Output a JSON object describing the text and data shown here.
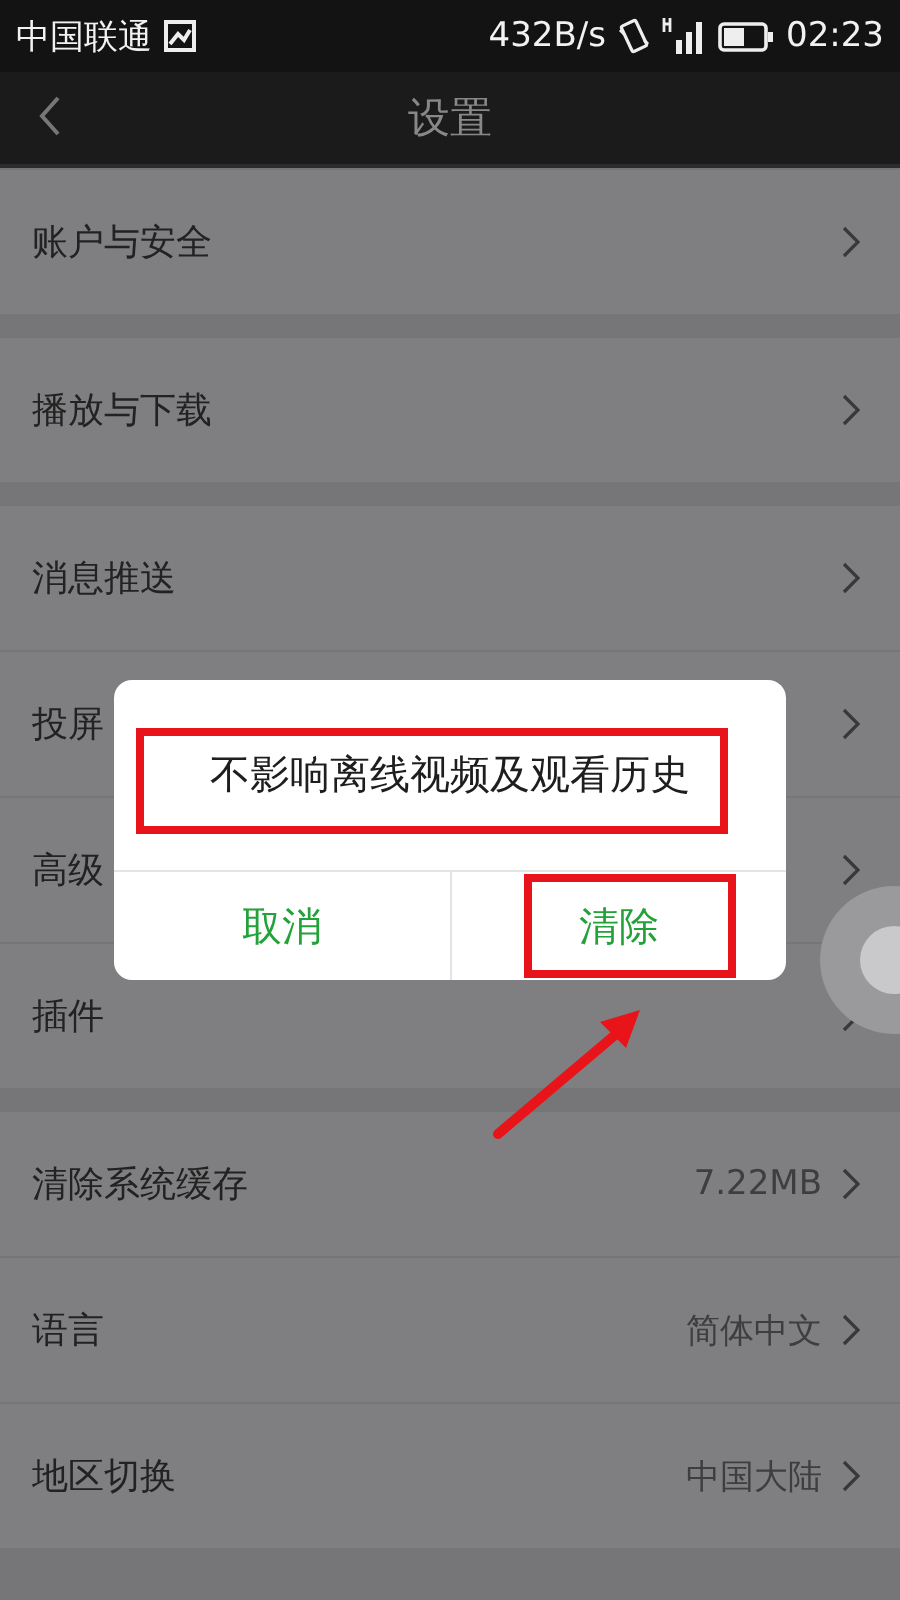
{
  "status_bar": {
    "carrier": "中国联通",
    "speed": "432B/s",
    "time": "02:23"
  },
  "nav": {
    "title": "设置"
  },
  "sections": [
    {
      "items": [
        {
          "label": "账户与安全"
        }
      ]
    },
    {
      "items": [
        {
          "label": "播放与下载"
        }
      ]
    },
    {
      "items": [
        {
          "label": "消息推送"
        },
        {
          "label": "投屏"
        },
        {
          "label": "高级"
        },
        {
          "label": "插件"
        }
      ]
    },
    {
      "items": [
        {
          "label": "清除系统缓存",
          "value": "7.22MB"
        },
        {
          "label": "语言",
          "value": "简体中文"
        },
        {
          "label": "地区切换",
          "value": "中国大陆"
        }
      ]
    }
  ],
  "dialog": {
    "message": "不影响离线视频及观看历史",
    "buttons": [
      {
        "label": "取消"
      },
      {
        "label": "清除"
      }
    ]
  }
}
